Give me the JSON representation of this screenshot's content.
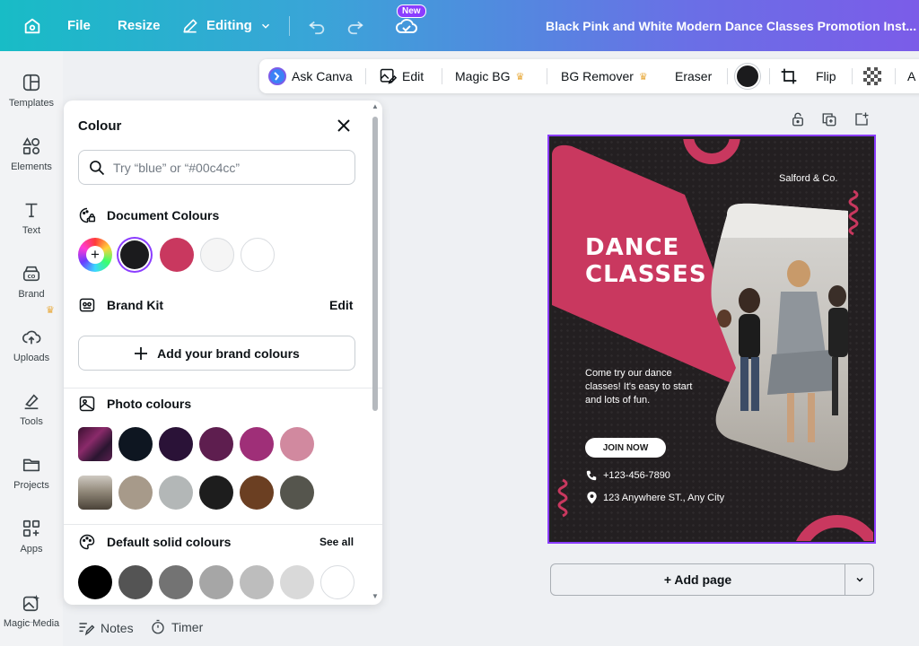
{
  "topbar": {
    "file": "File",
    "resize": "Resize",
    "editing": "Editing",
    "new_badge": "New",
    "doc_title": "Black Pink and White Modern Dance Classes Promotion Inst..."
  },
  "rail": {
    "items": [
      "Templates",
      "Elements",
      "Text",
      "Brand",
      "Uploads",
      "Tools",
      "Projects",
      "Apps",
      "Magic Media"
    ]
  },
  "context_toolbar": {
    "ask_canva": "Ask Canva",
    "edit": "Edit",
    "magic_bg": "Magic BG",
    "bg_remover": "BG Remover",
    "eraser": "Eraser",
    "flip": "Flip",
    "cut_off": "A"
  },
  "panel": {
    "title": "Colour",
    "search_placeholder": "Try “blue” or “#00c4cc”",
    "document_colours": {
      "title": "Document Colours",
      "swatches": [
        "#1b1b1d",
        "#c9385f",
        "#f5f5f5",
        "#ffffff"
      ]
    },
    "brand_kit": {
      "title": "Brand Kit",
      "edit": "Edit",
      "add_label": "Add your brand colours"
    },
    "photo_colours": {
      "title": "Photo colours",
      "row1": [
        "#0e1621",
        "#2a1237",
        "#5e1e4f",
        "#9f2f78",
        "#d1899f"
      ],
      "row2": [
        "#a79a8a",
        "#b3b7b7",
        "#1d1d1d",
        "#6b3f22",
        "#55554d"
      ]
    },
    "default_colours": {
      "title": "Default solid colours",
      "see_all": "See all",
      "swatches": [
        "#000000",
        "#545454",
        "#737373",
        "#a6a6a6",
        "#bdbdbd",
        "#d9d9d9",
        "#ffffff"
      ]
    }
  },
  "bottom": {
    "notes": "Notes",
    "timer": "Timer"
  },
  "design": {
    "brand": "Salford & Co.",
    "title_line1": "DANCE",
    "title_line2": "CLASSES",
    "body": "Come try our dance classes! It's easy to start and lots of fun.",
    "cta": "JOIN NOW",
    "phone": "+123-456-7890",
    "address": "123 Anywhere ST., Any City",
    "pink": "#c9385f"
  },
  "canvas": {
    "add_page": "+ Add page"
  }
}
